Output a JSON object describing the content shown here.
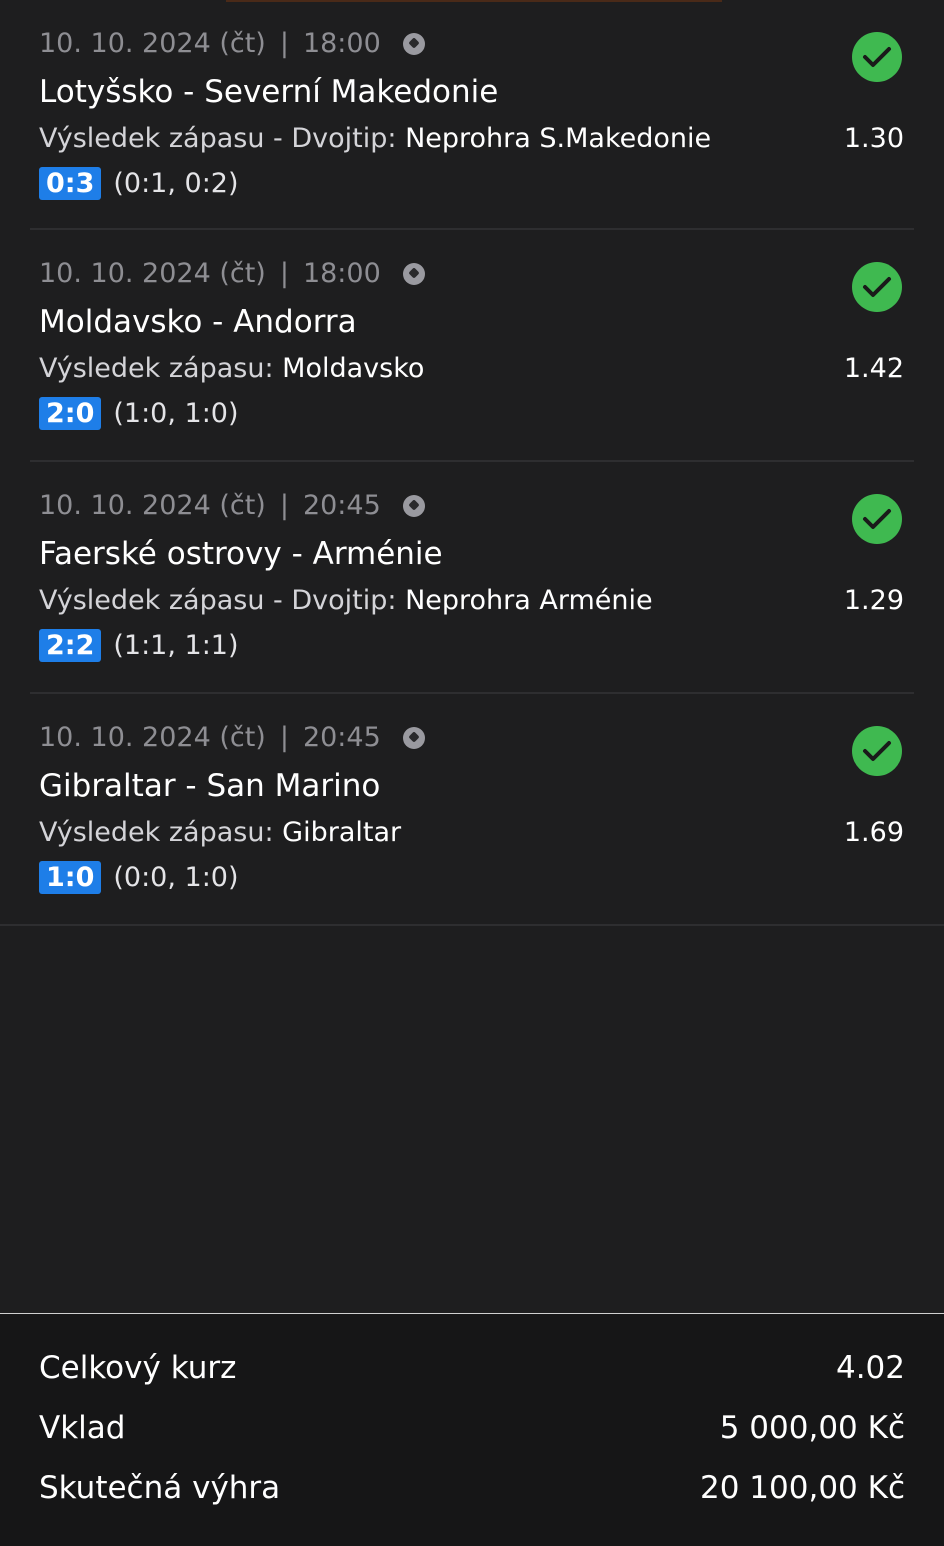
{
  "bets": [
    {
      "date": "10. 10. 2024 (čt)",
      "separator": "|",
      "time": "18:00",
      "sport_icon": "soccer-ball-icon",
      "teams": "Lotyšsko - Severní Makedonie",
      "market": "Výsledek zápasu - Dvojtip:",
      "pick": "Neprohra S.Makedonie",
      "odds": "1.30",
      "score": "0:3",
      "halves": "(0:1, 0:2)",
      "status_icon": "check-icon"
    },
    {
      "date": "10. 10. 2024 (čt)",
      "separator": "|",
      "time": "18:00",
      "sport_icon": "soccer-ball-icon",
      "teams": "Moldavsko - Andorra",
      "market": "Výsledek zápasu:",
      "pick": "Moldavsko",
      "odds": "1.42",
      "score": "2:0",
      "halves": "(1:0, 1:0)",
      "status_icon": "check-icon"
    },
    {
      "date": "10. 10. 2024 (čt)",
      "separator": "|",
      "time": "20:45",
      "sport_icon": "soccer-ball-icon",
      "teams": "Faerské ostrovy - Arménie",
      "market": "Výsledek zápasu - Dvojtip:",
      "pick": "Neprohra Arménie",
      "odds": "1.29",
      "score": "2:2",
      "halves": "(1:1, 1:1)",
      "status_icon": "check-icon"
    },
    {
      "date": "10. 10. 2024 (čt)",
      "separator": "|",
      "time": "20:45",
      "sport_icon": "soccer-ball-icon",
      "teams": "Gibraltar - San Marino",
      "market": "Výsledek zápasu:",
      "pick": "Gibraltar",
      "odds": "1.69",
      "score": "1:0",
      "halves": "(0:0, 1:0)",
      "status_icon": "check-icon"
    }
  ],
  "summary": {
    "total_odds_label": "Celkový kurz",
    "total_odds_value": "4.02",
    "stake_label": "Vklad",
    "stake_value": "5 000,00 Kč",
    "win_label": "Skutečná výhra",
    "win_value": "20 100,00 Kč"
  },
  "colors": {
    "background": "#1e1e1f",
    "summary_background": "#161617",
    "score_badge": "#1e7ee8",
    "win_check": "#3fb950",
    "muted_text": "#8e8e93"
  }
}
